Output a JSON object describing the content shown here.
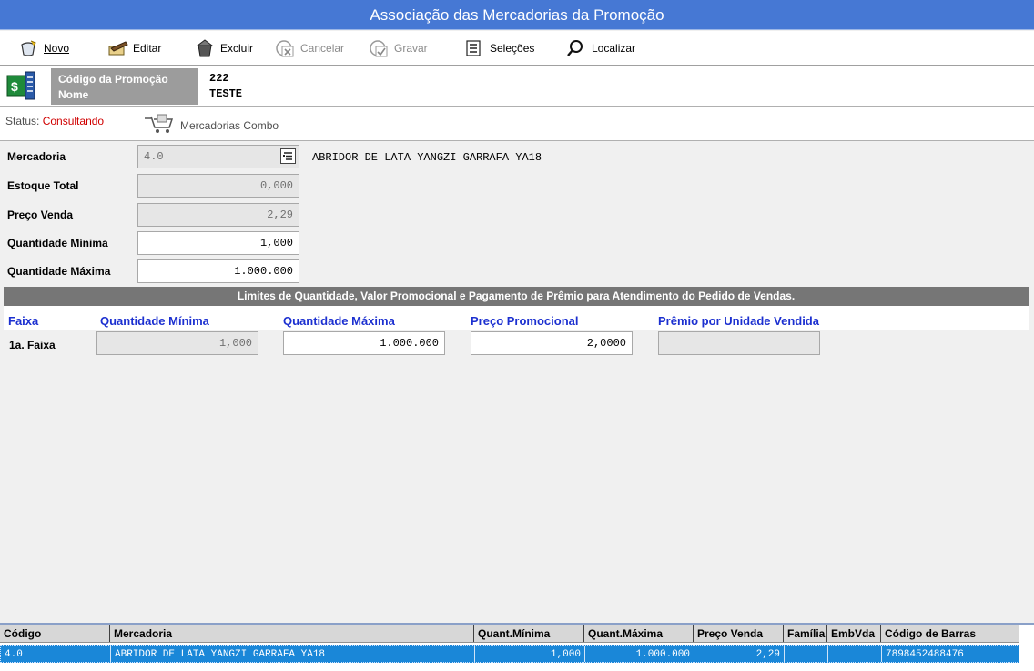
{
  "window": {
    "title": "Associação das Mercadorias da Promoção"
  },
  "toolbar": {
    "novo": "Novo",
    "editar": "Editar",
    "excluir": "Excluir",
    "cancelar": "Cancelar",
    "gravar": "Gravar",
    "selecoes": "Seleções",
    "localizar": "Localizar"
  },
  "header": {
    "codigo_label": "Código da Promoção",
    "nome_label": "Nome",
    "codigo_value": "222",
    "nome_value": "TESTE"
  },
  "status": {
    "label": "Status:",
    "value": "Consultando",
    "combo_button": "Mercadorias Combo"
  },
  "form": {
    "mercadoria_label": "Mercadoria",
    "mercadoria_code": "4.0",
    "mercadoria_desc": "ABRIDOR DE LATA YANGZI GARRAFA YA18",
    "estoque_label": "Estoque Total",
    "estoque_value": "0,000",
    "preco_label": "Preço Venda",
    "preco_value": "2,29",
    "qtd_min_label": "Quantidade Mínima",
    "qtd_min_value": "1,000",
    "qtd_max_label": "Quantidade Máxima",
    "qtd_max_value": "1.000.000"
  },
  "limits": {
    "title": "Limites de Quantidade, Valor Promocional  e Pagamento de Prêmio para Atendimento do Pedido de Vendas.",
    "headers": {
      "faixa": "Faixa",
      "qtd_min": "Quantidade Mínima",
      "qtd_max": "Quantidade Máxima",
      "preco": "Preço Promocional",
      "premio": "Prêmio por Unidade Vendida"
    },
    "row": {
      "faixa": "1a. Faixa",
      "qtd_min": "1,000",
      "qtd_max": "1.000.000",
      "preco": "2,0000",
      "premio": ""
    }
  },
  "grid": {
    "columns": [
      "Código",
      "Mercadoria",
      "Quant.Mínima",
      "Quant.Máxima",
      "Preço Venda",
      "Família",
      "EmbVda",
      "Código de Barras"
    ],
    "rows": [
      [
        "4.0",
        "ABRIDOR DE LATA YANGZI GARRAFA YA18",
        "1,000",
        "1.000.000",
        "2,29",
        "",
        "",
        "7898452488476"
      ]
    ]
  },
  "colors": {
    "titlebar": "#4678d4",
    "status_value": "#d00000",
    "limits_header_text": "#1c30d0",
    "selected_row": "#1a87d8"
  }
}
